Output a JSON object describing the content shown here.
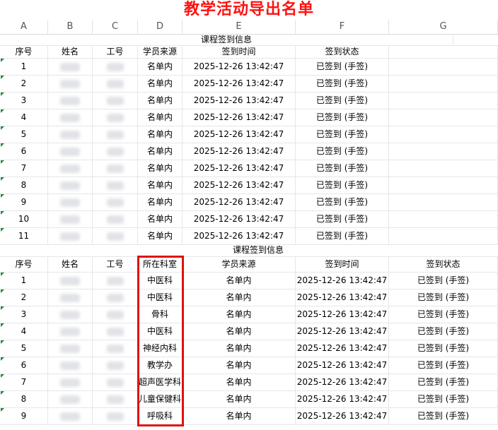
{
  "title": "教学活动导出名单",
  "columns": [
    "A",
    "B",
    "C",
    "D",
    "E",
    "F",
    "G"
  ],
  "section1": {
    "title": "课程签到信息",
    "headers": [
      "序号",
      "姓名",
      "工号",
      "学员来源",
      "签到时间",
      "签到状态"
    ],
    "rows": [
      [
        "1",
        "",
        "",
        "名单内",
        "2025-12-26 13:42:47",
        "已签到 (手签)"
      ],
      [
        "2",
        "",
        "",
        "名单内",
        "2025-12-26 13:42:47",
        "已签到 (手签)"
      ],
      [
        "3",
        "",
        "",
        "名单内",
        "2025-12-26 13:42:47",
        "已签到 (手签)"
      ],
      [
        "4",
        "",
        "",
        "名单内",
        "2025-12-26 13:42:47",
        "已签到 (手签)"
      ],
      [
        "5",
        "",
        "",
        "名单内",
        "2025-12-26 13:42:47",
        "已签到 (手签)"
      ],
      [
        "6",
        "",
        "",
        "名单内",
        "2025-12-26 13:42:47",
        "已签到 (手签)"
      ],
      [
        "7",
        "",
        "",
        "名单内",
        "2025-12-26 13:42:47",
        "已签到 (手签)"
      ],
      [
        "8",
        "",
        "",
        "名单内",
        "2025-12-26 13:42:47",
        "已签到 (手签)"
      ],
      [
        "9",
        "",
        "",
        "名单内",
        "2025-12-26 13:42:47",
        "已签到 (手签)"
      ],
      [
        "10",
        "",
        "",
        "名单内",
        "2025-12-26 13:42:47",
        "已签到 (手签)"
      ],
      [
        "11",
        "",
        "",
        "名单内",
        "2025-12-26 13:42:47",
        "已签到 (手签)"
      ]
    ]
  },
  "section2": {
    "title": "课程签到信息",
    "headers": [
      "序号",
      "姓名",
      "工号",
      "所在科室",
      "学员来源",
      "签到时间",
      "签到状态"
    ],
    "rows": [
      [
        "1",
        "",
        "",
        "中医科",
        "名单内",
        "2025-12-26 13:42:47",
        "已签到 (手签)"
      ],
      [
        "2",
        "",
        "",
        "中医科",
        "名单内",
        "2025-12-26 13:42:47",
        "已签到 (手签)"
      ],
      [
        "3",
        "",
        "",
        "骨科",
        "名单内",
        "2025-12-26 13:42:47",
        "已签到 (手签)"
      ],
      [
        "4",
        "",
        "",
        "中医科",
        "名单内",
        "2025-12-26 13:42:47",
        "已签到 (手签)"
      ],
      [
        "5",
        "",
        "",
        "神经内科",
        "名单内",
        "2025-12-26 13:42:47",
        "已签到 (手签)"
      ],
      [
        "6",
        "",
        "",
        "教学办",
        "名单内",
        "2025-12-26 13:42:47",
        "已签到 (手签)"
      ],
      [
        "7",
        "",
        "",
        "超声医学科",
        "名单内",
        "2025-12-26 13:42:47",
        "已签到 (手签)"
      ],
      [
        "8",
        "",
        "",
        "儿童保健科",
        "名单内",
        "2025-12-26 13:42:47",
        "已签到 (手签)"
      ],
      [
        "9",
        "",
        "",
        "呼吸科",
        "名单内",
        "2025-12-26 13:42:47",
        "已签到 (手签)"
      ]
    ]
  },
  "colors": {
    "title": "#ff1010",
    "highlight": "#e01010",
    "marker": "#1f8a3a"
  }
}
